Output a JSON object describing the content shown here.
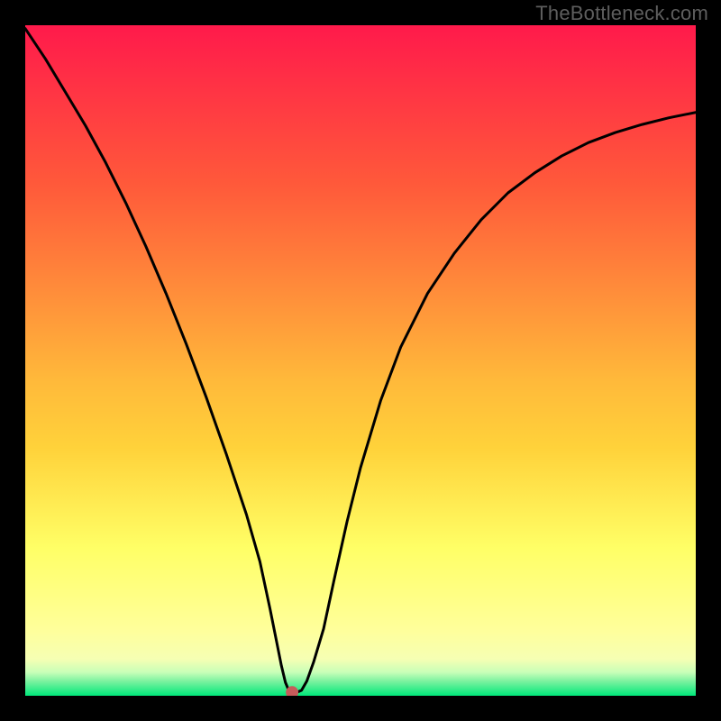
{
  "watermark_text": "TheBottleneck.com",
  "chart_data": {
    "type": "line",
    "title": "",
    "xlabel": "",
    "ylabel": "",
    "xlim": [
      0,
      100
    ],
    "ylim": [
      0,
      100
    ],
    "grid": false,
    "legend": false,
    "background_gradient": {
      "top_color": "#ff1a4b",
      "mid_colors": [
        "#ff7a3a",
        "#ffd23a",
        "#ffff66",
        "#f6ffb3"
      ],
      "bottom_color": "#00e87a"
    },
    "series": [
      {
        "name": "bottleneck-curve",
        "color": "#000000",
        "x": [
          0,
          3,
          6,
          9,
          12,
          15,
          18,
          21,
          24,
          27,
          30,
          33,
          35,
          36.5,
          37.5,
          38.2,
          38.8,
          39.3,
          40.5,
          41.2,
          42,
          43,
          44.5,
          46,
          48,
          50,
          53,
          56,
          60,
          64,
          68,
          72,
          76,
          80,
          84,
          88,
          92,
          96,
          100
        ],
        "values": [
          99.5,
          95,
          90,
          85,
          79.5,
          73.5,
          67,
          60,
          52.5,
          44.5,
          36,
          27,
          20,
          13,
          8,
          4.5,
          2,
          0.8,
          0.5,
          0.8,
          2.2,
          5,
          10,
          17,
          26,
          34,
          44,
          52,
          60,
          66,
          71,
          75,
          78,
          80.5,
          82.5,
          84,
          85.2,
          86.2,
          87
        ]
      }
    ],
    "marker": {
      "name": "sweet-spot-marker",
      "x": 39.8,
      "y": 0.5,
      "color": "#c65b5b",
      "radius_px": 7
    },
    "annotations": []
  }
}
